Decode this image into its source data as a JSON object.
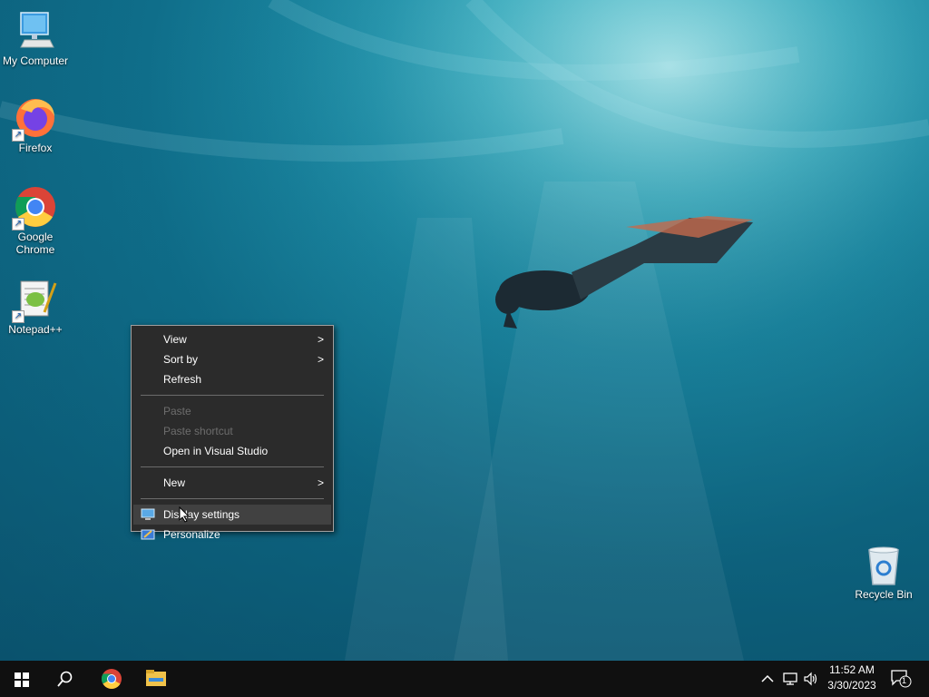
{
  "desktop": {
    "icons": [
      {
        "label": "My Computer",
        "icon": "computer-icon"
      },
      {
        "label": "Firefox",
        "icon": "firefox-icon"
      },
      {
        "label": "Google Chrome",
        "icon": "chrome-icon"
      },
      {
        "label": "Notepad++",
        "icon": "notepadpp-icon"
      },
      {
        "label": "Recycle Bin",
        "icon": "recycle-bin-icon"
      }
    ]
  },
  "context_menu": {
    "items": [
      {
        "label": "View",
        "submenu": true,
        "enabled": true
      },
      {
        "label": "Sort by",
        "submenu": true,
        "enabled": true
      },
      {
        "label": "Refresh",
        "submenu": false,
        "enabled": true
      },
      {
        "label": "Paste",
        "submenu": false,
        "enabled": false
      },
      {
        "label": "Paste shortcut",
        "submenu": false,
        "enabled": false
      },
      {
        "label": "Open in Visual Studio",
        "submenu": false,
        "enabled": true
      },
      {
        "label": "New",
        "submenu": true,
        "enabled": true
      },
      {
        "label": "Display settings",
        "submenu": false,
        "enabled": true,
        "icon": "display-settings-icon",
        "hovered": true
      },
      {
        "label": "Personalize",
        "submenu": false,
        "enabled": true,
        "icon": "personalize-icon"
      }
    ]
  },
  "taskbar": {
    "pinned": [
      "start-icon",
      "search-icon",
      "chrome-icon",
      "file-explorer-icon"
    ],
    "tray_icons": [
      "chevron-up-icon",
      "network-icon",
      "volume-icon"
    ],
    "time": "11:52 AM",
    "date": "3/30/2023",
    "notification_count": "1"
  },
  "colors": {
    "taskbar": "#101010",
    "menu_bg": "#2b2b2b",
    "menu_hover": "#414141",
    "disabled_text": "#6d6d6d"
  }
}
